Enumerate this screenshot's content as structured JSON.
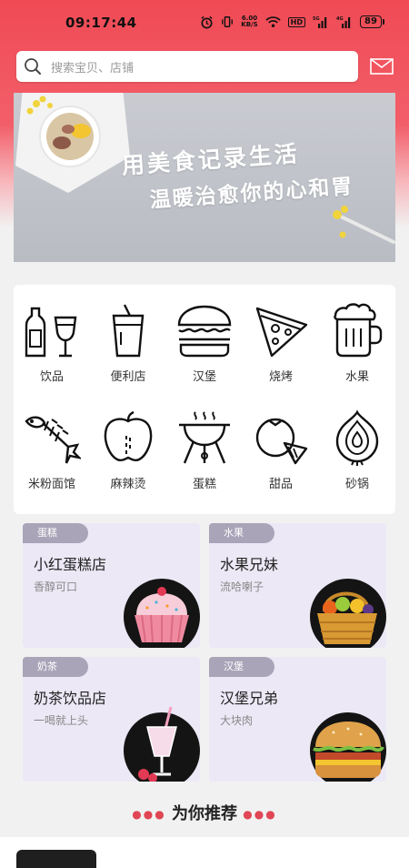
{
  "status_bar": {
    "time": "09:17:44",
    "speed_value": "6.00",
    "speed_unit": "KB/S",
    "hd": "HD",
    "signal_labels": [
      "5G",
      "4G"
    ],
    "battery": "89"
  },
  "search": {
    "placeholder": "搜索宝贝、店铺"
  },
  "banner": {
    "line1": "用美食记录生活",
    "line2": "温暖治愈你的心和胃"
  },
  "categories": [
    {
      "label": "饮品",
      "icon": "drinks-icon"
    },
    {
      "label": "便利店",
      "icon": "cup-icon"
    },
    {
      "label": "汉堡",
      "icon": "burger-icon"
    },
    {
      "label": "烧烤",
      "icon": "pizza-icon"
    },
    {
      "label": "水果",
      "icon": "beer-icon"
    },
    {
      "label": "米粉面馆",
      "icon": "fish-bone-icon"
    },
    {
      "label": "麻辣烫",
      "icon": "apple-icon"
    },
    {
      "label": "蛋糕",
      "icon": "grill-icon"
    },
    {
      "label": "甜品",
      "icon": "fruit-icon"
    },
    {
      "label": "砂锅",
      "icon": "onion-icon"
    }
  ],
  "shops": [
    {
      "tag": "蛋糕",
      "name": "小红蛋糕店",
      "desc": "香醇可口"
    },
    {
      "tag": "水果",
      "name": "水果兄妹",
      "desc": "流哈喇子"
    },
    {
      "tag": "奶茶",
      "name": "奶茶饮品店",
      "desc": "一喝就上头"
    },
    {
      "tag": "汉堡",
      "name": "汉堡兄弟",
      "desc": "大块肉"
    }
  ],
  "recommend": {
    "title": "为你推荐"
  },
  "colors": {
    "brand_red": "#f04a55",
    "card_bg": "#ece8f6",
    "tag_bg": "#a9a4b8"
  }
}
